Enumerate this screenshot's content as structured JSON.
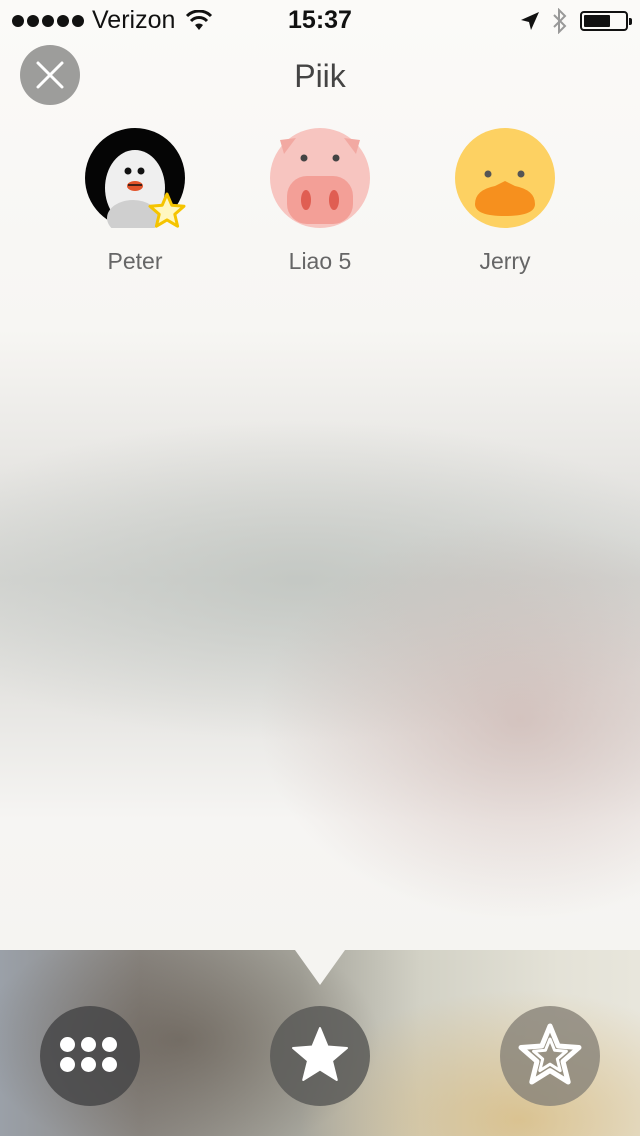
{
  "status_bar": {
    "carrier": "Verizon",
    "time": "15:37",
    "signal_icon": "signal-dots-icon",
    "wifi_icon": "wifi-icon",
    "location_icon": "location-arrow-icon",
    "bluetooth_icon": "bluetooth-icon",
    "battery_icon": "battery-icon"
  },
  "header": {
    "title": "Piik",
    "close_icon": "close-icon"
  },
  "friends": [
    {
      "name": "Peter",
      "avatar": "penguin-avatar",
      "favorite": true
    },
    {
      "name": "Liao 5",
      "avatar": "pig-avatar",
      "favorite": false
    },
    {
      "name": "Jerry",
      "avatar": "duck-avatar",
      "favorite": false
    }
  ],
  "bottom_bar": {
    "buttons": [
      {
        "icon": "grid-icon",
        "selected": false
      },
      {
        "icon": "star-filled-icon",
        "selected": true
      },
      {
        "icon": "star-outline-icon",
        "selected": false
      }
    ]
  },
  "colors": {
    "star_accent": "#f5c400",
    "pig_pink": "#f7c5c0",
    "duck_yellow": "#fdd162",
    "duck_beak": "#f6901e"
  }
}
